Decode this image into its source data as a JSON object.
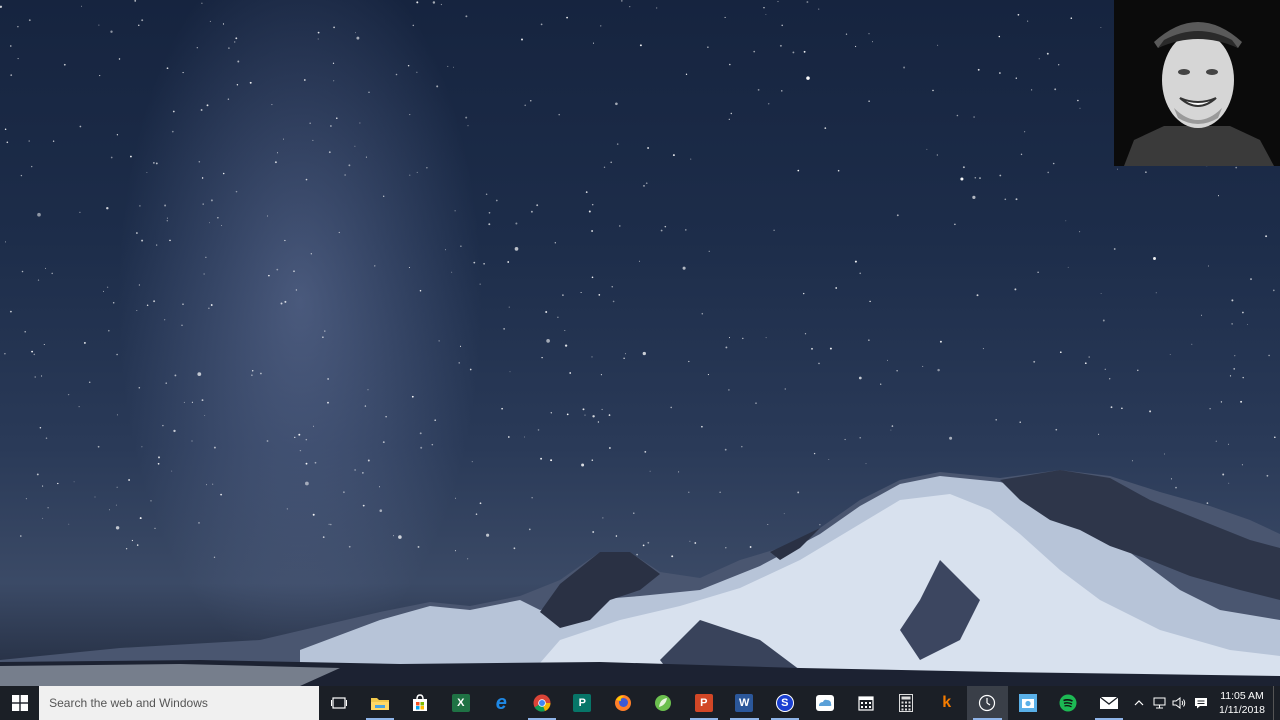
{
  "search": {
    "placeholder": "Search the web and Windows"
  },
  "taskbar": {
    "apps": [
      {
        "name": "task-view",
        "label": "",
        "color": "#1b1f26"
      },
      {
        "name": "file-explorer",
        "label": "",
        "color": "#f2c94c"
      },
      {
        "name": "store",
        "label": "",
        "color": "#ffffff"
      },
      {
        "name": "excel",
        "label": "X",
        "color": "#1f7244"
      },
      {
        "name": "edge",
        "label": "e",
        "color": "#1e88e5"
      },
      {
        "name": "chrome",
        "label": "",
        "color": "#e53935"
      },
      {
        "name": "publisher",
        "label": "P",
        "color": "#077568"
      },
      {
        "name": "firefox",
        "label": "",
        "color": "#ff7f2a"
      },
      {
        "name": "app-green",
        "label": "",
        "color": "#6bbf4e"
      },
      {
        "name": "powerpoint",
        "label": "P",
        "color": "#d24726"
      },
      {
        "name": "word",
        "label": "W",
        "color": "#2b579a"
      },
      {
        "name": "snagit",
        "label": "S",
        "color": "#1a3fd1"
      },
      {
        "name": "onedrive",
        "label": "",
        "color": "#5aa0d8"
      },
      {
        "name": "calendar",
        "label": "",
        "color": "#ffffff"
      },
      {
        "name": "calculator",
        "label": "",
        "color": "#dddddd"
      },
      {
        "name": "app-k",
        "label": "k",
        "color": "#f57c00"
      },
      {
        "name": "clock-app",
        "label": "",
        "color": "#ffffff"
      },
      {
        "name": "photos",
        "label": "",
        "color": "#5ab0e8"
      },
      {
        "name": "spotify",
        "label": "",
        "color": "#1db954"
      },
      {
        "name": "mail",
        "label": "",
        "color": "#ffffff"
      }
    ]
  },
  "clock": {
    "time": "11:05 AM",
    "date": "1/11/2018"
  }
}
